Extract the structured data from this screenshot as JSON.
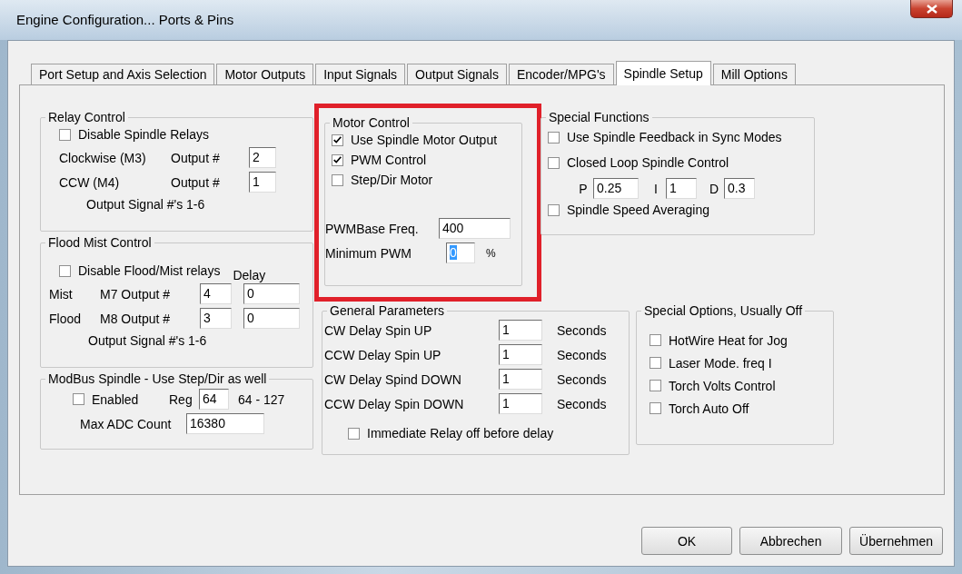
{
  "window": {
    "title": "Engine Configuration... Ports & Pins"
  },
  "tabs": [
    {
      "label": "Port Setup and Axis Selection",
      "selected": false
    },
    {
      "label": "Motor Outputs",
      "selected": false
    },
    {
      "label": "Input Signals",
      "selected": false
    },
    {
      "label": "Output Signals",
      "selected": false
    },
    {
      "label": "Encoder/MPG's",
      "selected": false
    },
    {
      "label": "Spindle Setup",
      "selected": true
    },
    {
      "label": "Mill Options",
      "selected": false
    }
  ],
  "relay_control": {
    "title": "Relay Control",
    "checkbox": {
      "label": "Disable Spindle Relays",
      "checked": false
    },
    "outputs": [
      {
        "label": "Clockwise (M3)",
        "field_label": "Output #",
        "value": "2"
      },
      {
        "label": "CCW (M4)",
        "field_label": "Output #",
        "value": "1"
      }
    ],
    "note": "Output Signal #'s 1-6"
  },
  "flood_mist_control": {
    "title": "Flood Mist Control",
    "checkbox": {
      "label": "Disable Flood/Mist relays",
      "checked": false
    },
    "delay_label": "Delay",
    "outputs": [
      {
        "label": "Mist",
        "field_label": "M7 Output #",
        "value": "4",
        "delay": "0"
      },
      {
        "label": "Flood",
        "field_label": "M8 Output #",
        "value": "3",
        "delay": "0"
      }
    ],
    "note": "Output Signal #'s 1-6"
  },
  "modbus_spindle": {
    "title": "ModBus Spindle - Use Step/Dir as well",
    "enabled": {
      "label": "Enabled",
      "checked": false
    },
    "reg_label": "Reg",
    "reg_value": "64",
    "reg_range": "64 - 127",
    "adc_label": "Max ADC Count",
    "adc_value": "16380"
  },
  "motor_control": {
    "title": "Motor Control",
    "highlighted": true,
    "checkboxes": [
      {
        "label": "Use Spindle Motor Output",
        "checked": true
      },
      {
        "label": "PWM Control",
        "checked": true
      },
      {
        "label": "Step/Dir Motor",
        "checked": false
      }
    ],
    "pwm_base_label": "PWMBase Freq.",
    "pwm_base_value": "400",
    "min_pwm_label": "Minimum PWM",
    "min_pwm_value": "0",
    "min_pwm_value_selected": true,
    "min_pwm_unit": "%"
  },
  "special_functions": {
    "title": "Special Functions",
    "checkboxes": [
      {
        "label": "Use Spindle Feedback in Sync Modes",
        "checked": false
      },
      {
        "label": "Closed Loop Spindle Control",
        "checked": false
      }
    ],
    "pid": [
      {
        "label": "P",
        "value": "0.25"
      },
      {
        "label": "I",
        "value": "1"
      },
      {
        "label": "D",
        "value": "0.3"
      }
    ],
    "averaging": {
      "label": "Spindle Speed Averaging",
      "checked": false
    }
  },
  "general_parameters": {
    "title": "General Parameters",
    "rows": [
      {
        "label": "CW Delay Spin UP",
        "value": "1",
        "unit": "Seconds"
      },
      {
        "label": "CCW Delay Spin UP",
        "value": "1",
        "unit": "Seconds"
      },
      {
        "label": "CW Delay Spind DOWN",
        "value": "1",
        "unit": "Seconds"
      },
      {
        "label": "CCW Delay Spin DOWN",
        "value": "1",
        "unit": "Seconds"
      }
    ],
    "checkbox": {
      "label": "Immediate Relay off before delay",
      "checked": false
    }
  },
  "special_options": {
    "title": "Special Options, Usually Off",
    "checkboxes": [
      {
        "label": "HotWire Heat for Jog",
        "checked": false
      },
      {
        "label": "Laser Mode. freq I",
        "checked": false
      },
      {
        "label": "Torch Volts Control",
        "checked": false
      },
      {
        "label": "Torch Auto Off",
        "checked": false
      }
    ]
  },
  "buttons": [
    "OK",
    "Abbrechen",
    "Übernehmen"
  ]
}
